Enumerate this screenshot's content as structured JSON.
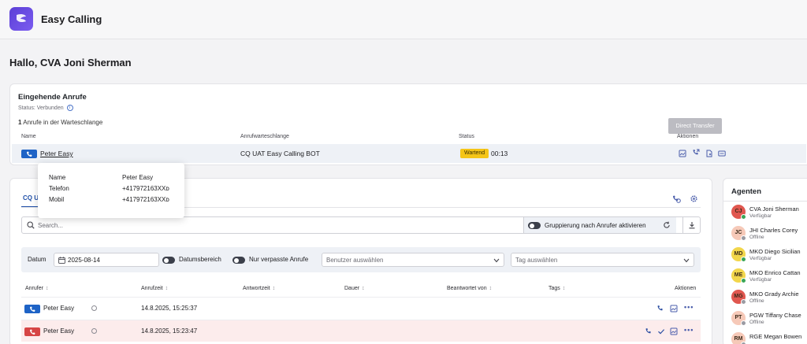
{
  "app": {
    "title": "Easy Calling"
  },
  "greeting": "Hallo, CVA Joni Sherman",
  "incoming": {
    "title": "Eingehende Anrufe",
    "status_label": "Status: Verbunden",
    "queue_count": "1",
    "queue_count_suffix": " Anrufe in der Warteschlange",
    "columns": {
      "name": "Name",
      "queue": "Anrufwarteschlange",
      "status": "Status",
      "actions": "Aktionen"
    },
    "row": {
      "caller": "Peter Easy",
      "queue": "CQ UAT Easy Calling BOT",
      "status": "Wartend",
      "wait_time": "00:13"
    },
    "tooltip": "Direct Transfer"
  },
  "caller_popup": {
    "name_label": "Name",
    "name_value": "Peter Easy",
    "phone_label": "Telefon",
    "phone_value": "+417972163XX⁠ᴅ",
    "mobile_label": "Mobil",
    "mobile_value": "+417972163XX⁠ᴅ"
  },
  "calls": {
    "tab_label": "CQ U",
    "search_placeholder": "Search...",
    "group_toggle_label": "Gruppierung nach Anrufer aktivieren",
    "filters": {
      "date_label": "Datum",
      "date_value": "2025-08-14",
      "date_range_label": "Datumsbereich",
      "missed_only_label": "Nur verpasste Anrufe",
      "user_placeholder": "Benutzer auswählen",
      "tag_placeholder": "Tag auswählen"
    },
    "columns": {
      "caller": "Anrufer",
      "call_time": "Anrufzeit",
      "answer_time": "Antwortzeit",
      "duration": "Dauer",
      "answered_by": "Beantwortet von",
      "tags": "Tags",
      "actions": "Aktionen"
    },
    "rows": [
      {
        "caller": "Peter Easy",
        "call_time": "14.8.2025, 15:25:37",
        "missed": false
      },
      {
        "caller": "Peter Easy",
        "call_time": "14.8.2025, 15:23:47",
        "missed": true
      }
    ]
  },
  "agents": {
    "title": "Agenten",
    "list": [
      {
        "initials": "CJ",
        "name": "CVA Joni Sherman",
        "status": "Verfügbar",
        "avatar_color": "#e0574f",
        "presence_color": "#3aa657"
      },
      {
        "initials": "JC",
        "name": "JHI Charles Corey",
        "status": "Offline",
        "avatar_color": "#f6c9b8",
        "presence_color": "#9a9aa2"
      },
      {
        "initials": "MD",
        "name": "MKO Diego Sicilian",
        "status": "Verfügbar",
        "avatar_color": "#f2d64b",
        "presence_color": "#3aa657"
      },
      {
        "initials": "ME",
        "name": "MKO Enrico Cattan",
        "status": "Verfügbar",
        "avatar_color": "#f2d64b",
        "presence_color": "#3aa657"
      },
      {
        "initials": "MG",
        "name": "MKO Grady Archie",
        "status": "Offline",
        "avatar_color": "#e0574f",
        "presence_color": "#9a9aa2"
      },
      {
        "initials": "PT",
        "name": "PGW Tiffany Chase",
        "status": "Offline",
        "avatar_color": "#f6c9b8",
        "presence_color": "#9a9aa2"
      },
      {
        "initials": "RM",
        "name": "RGE Megan Bowen",
        "status": "",
        "avatar_color": "#f6c9b8",
        "presence_color": "#9a9aa2"
      }
    ]
  },
  "colors": {
    "accent": "#1f4fa8",
    "waiting": "#f5c518",
    "missed_row": "#fcecec",
    "brand": "#5b3fd6"
  }
}
